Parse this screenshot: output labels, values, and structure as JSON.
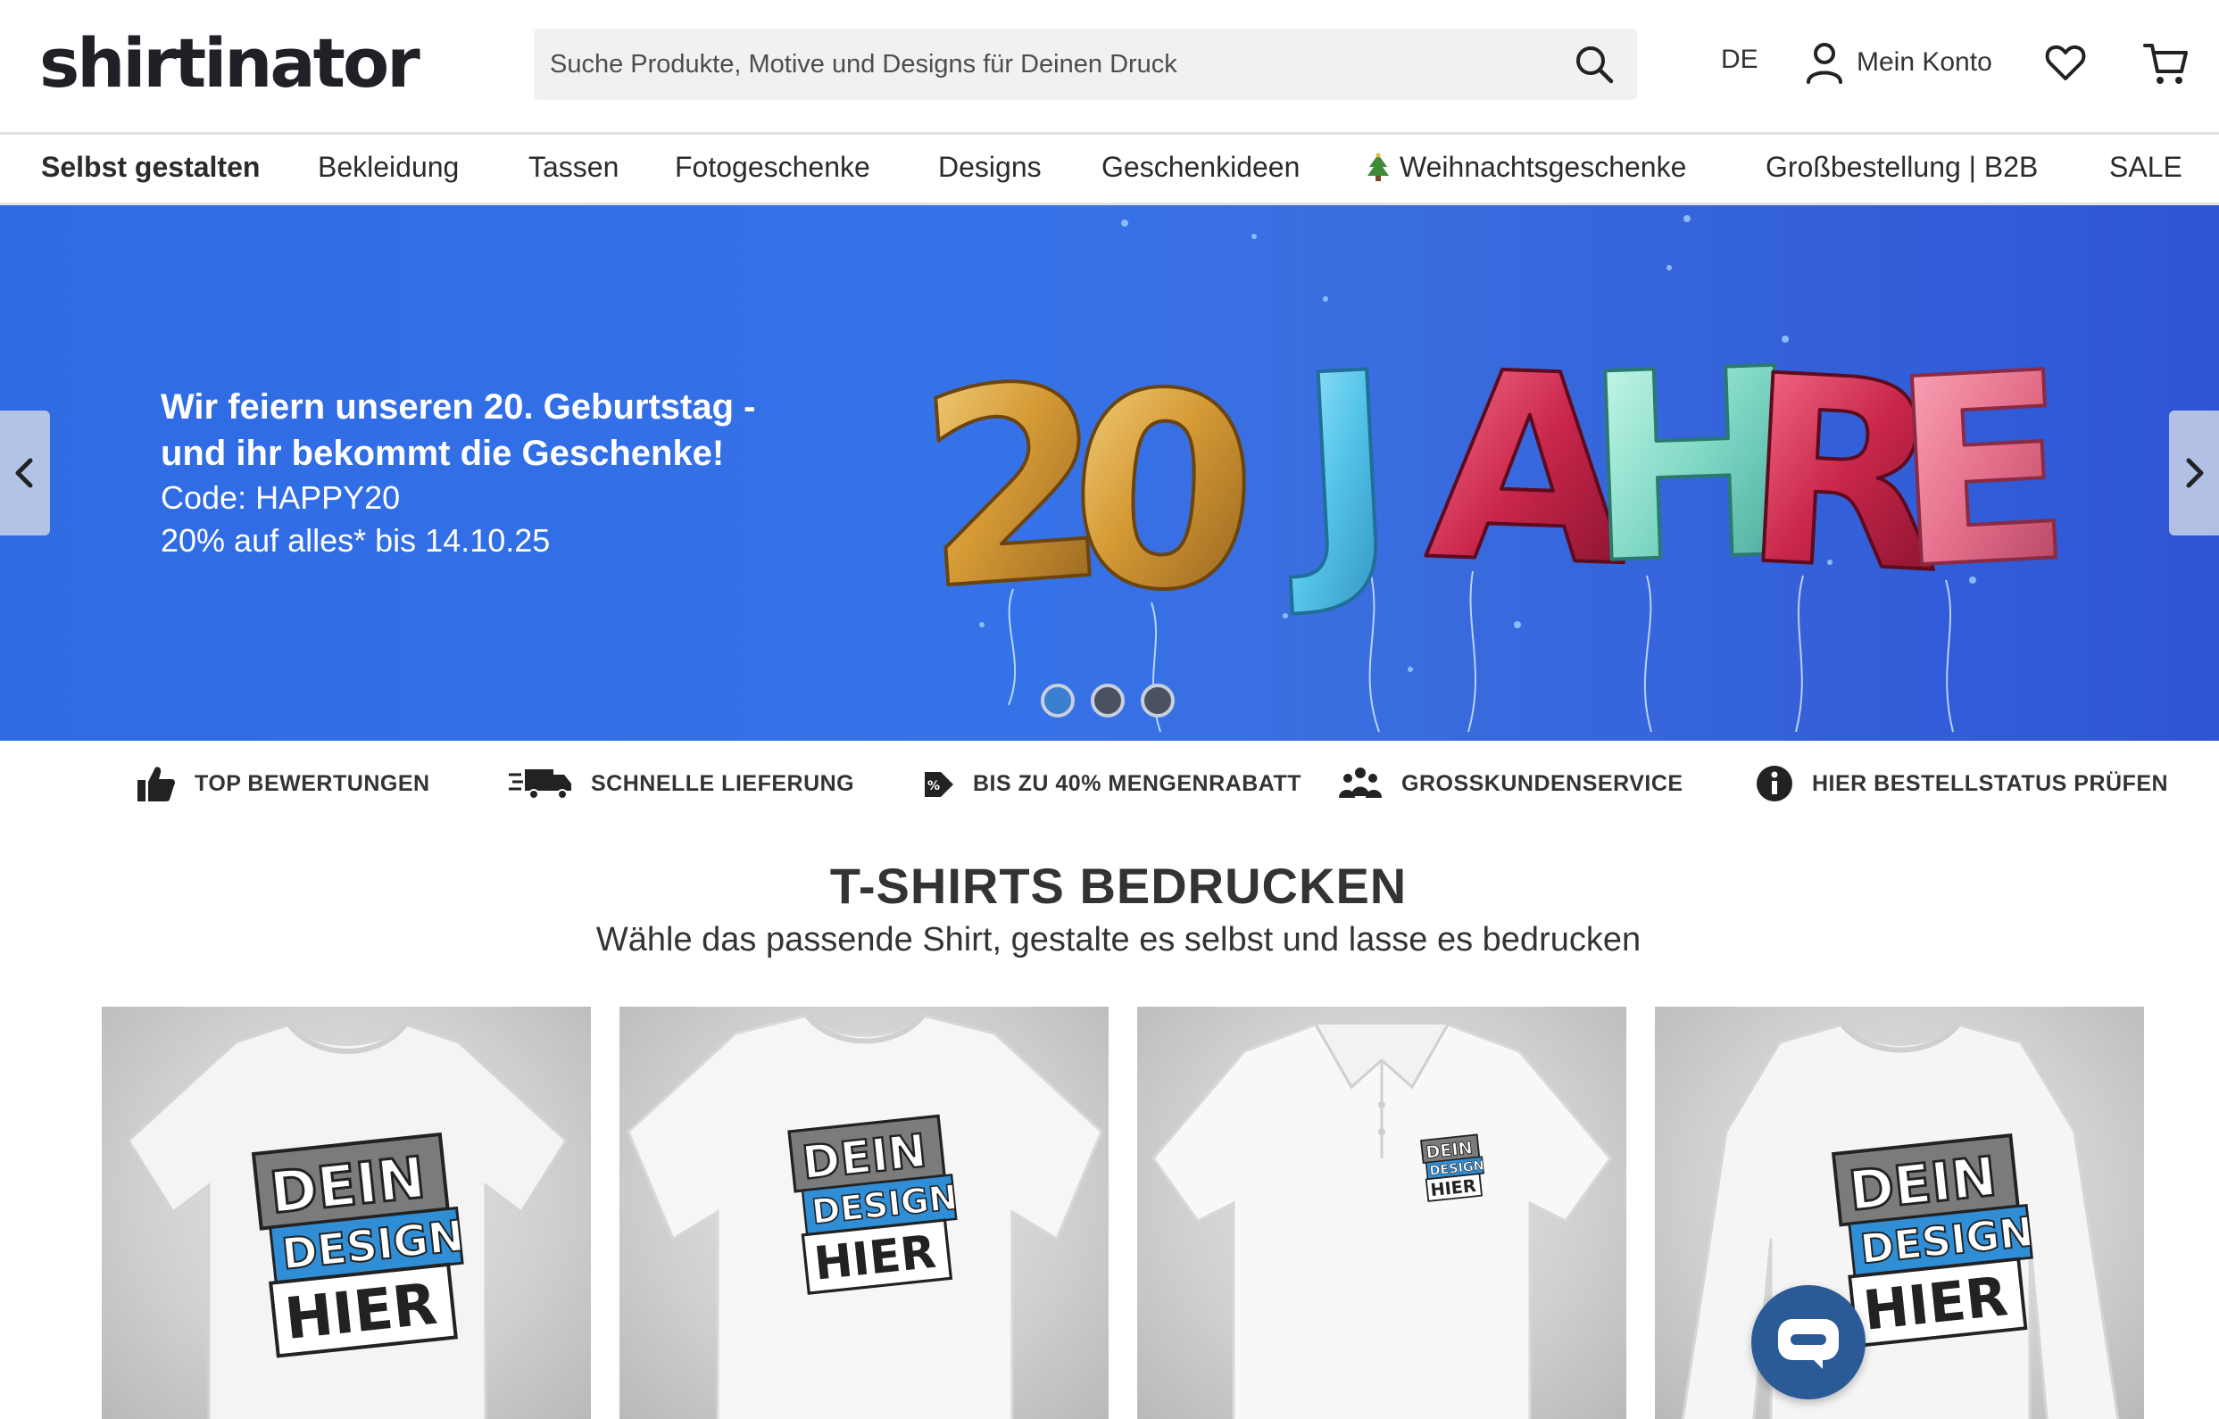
{
  "header": {
    "logo_text": "shirtinator",
    "search_placeholder": "Suche Produkte, Motive und Designs für Deinen Druck",
    "language": "DE",
    "account_label": "Mein Konto"
  },
  "nav": {
    "items": [
      {
        "label": "Selbst gestalten"
      },
      {
        "label": "Bekleidung"
      },
      {
        "label": "Tassen"
      },
      {
        "label": "Fotogeschenke"
      },
      {
        "label": "Designs"
      },
      {
        "label": "Geschenkideen"
      },
      {
        "label": "Weihnachtsgeschenke"
      },
      {
        "label": "Großbestellung | B2B"
      },
      {
        "label": "SALE"
      }
    ]
  },
  "hero": {
    "headline_line1": "Wir feiern unseren 20. Geburtstag -",
    "headline_line2": "und ihr bekommt die Geschenke!",
    "code_line": "Code: HAPPY20",
    "discount_line": "20% auf alles* bis 14.10.25",
    "image_text_number": "20",
    "image_text_word": "JAHRE",
    "slides_total": 3,
    "active_slide": 1
  },
  "usp": {
    "items": [
      {
        "label": "TOP BEWERTUNGEN",
        "icon": "thumbs-up-icon"
      },
      {
        "label": "SCHNELLE LIEFERUNG",
        "icon": "delivery-truck-icon"
      },
      {
        "label": "BIS ZU 40% MENGENRABATT",
        "icon": "discount-tag-icon"
      },
      {
        "label": "GROSSKUNDENSERVICE",
        "icon": "group-icon"
      },
      {
        "label": "HIER BESTELLSTATUS PRÜFEN",
        "icon": "info-icon"
      }
    ]
  },
  "section": {
    "title": "T-SHIRTS BEDRUCKEN",
    "subtitle": "Wähle das passende Shirt, gestalte es selbst und lasse es bedrucken"
  },
  "products": [
    {
      "print_line1": "DEIN",
      "print_line2": "DESIGN",
      "print_line3": "HIER"
    },
    {
      "print_line1": "DEIN",
      "print_line2": "DESIGN",
      "print_line3": "HIER"
    },
    {
      "print_line1": "DEIN",
      "print_line2": "DESIGN",
      "print_line3": "HIER"
    },
    {
      "print_line1": "DEIN",
      "print_line2": "DESIGN",
      "print_line3": "HIER"
    }
  ],
  "colors": {
    "brand_blue": "#3a7fd0",
    "hero_blue": "#3572e8",
    "chat_blue": "#2b5b97"
  }
}
